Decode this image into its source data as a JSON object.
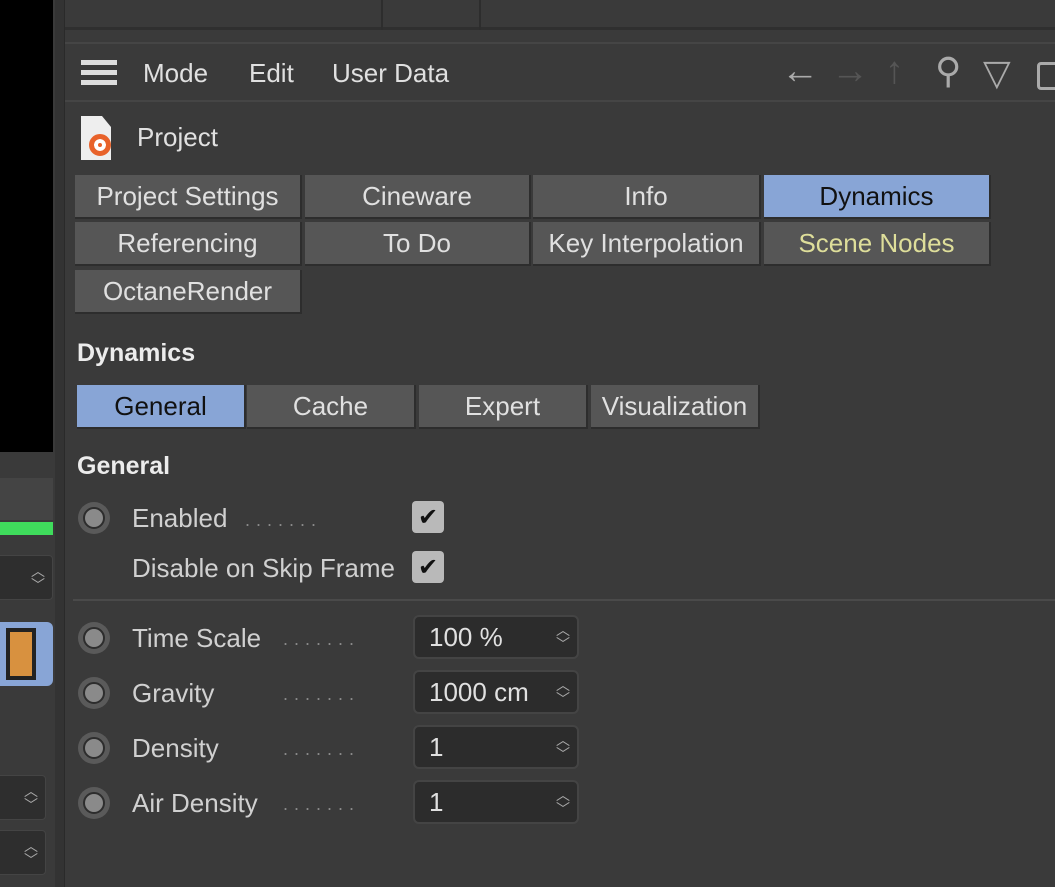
{
  "menu": {
    "items": [
      "Mode",
      "Edit",
      "User Data"
    ]
  },
  "object": {
    "title": "Project"
  },
  "tabs": [
    {
      "label": "Project Settings",
      "active": false
    },
    {
      "label": "Cineware",
      "active": false
    },
    {
      "label": "Info",
      "active": false
    },
    {
      "label": "Dynamics",
      "active": true
    },
    {
      "label": "Referencing",
      "active": false
    },
    {
      "label": "To Do",
      "active": false
    },
    {
      "label": "Key Interpolation",
      "active": false
    },
    {
      "label": "Scene Nodes",
      "active": false,
      "color": "#dede9a"
    },
    {
      "label": "OctaneRender",
      "active": false
    }
  ],
  "section_title": "Dynamics",
  "subtabs": [
    {
      "label": "General",
      "active": true
    },
    {
      "label": "Cache",
      "active": false
    },
    {
      "label": "Expert",
      "active": false
    },
    {
      "label": "Visualization",
      "active": false
    }
  ],
  "group_title": "General",
  "checks": [
    {
      "label": "Enabled",
      "checked": true
    },
    {
      "label": "Disable on Skip Frame",
      "checked": true
    }
  ],
  "fields": [
    {
      "label": "Time Scale",
      "value": "100 %"
    },
    {
      "label": "Gravity",
      "value": "1000 cm"
    },
    {
      "label": "Density",
      "value": "1"
    },
    {
      "label": "Air Density",
      "value": "1"
    }
  ],
  "colors": {
    "accent": "#88a5d6",
    "background": "#3a3a3a",
    "tab": "#565656",
    "green_bar": "#3fdc5c"
  }
}
